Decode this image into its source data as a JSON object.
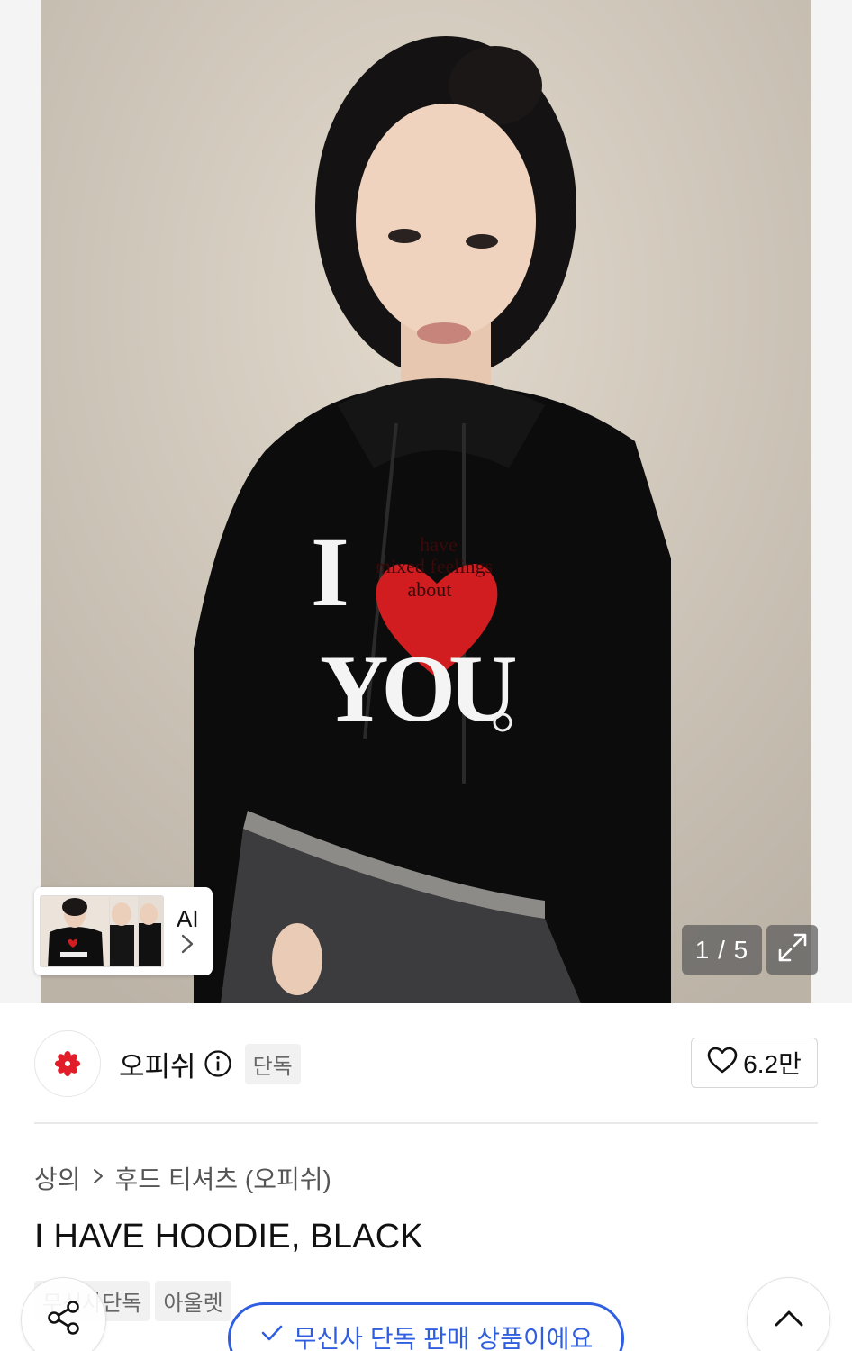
{
  "gallery": {
    "counter": "1 / 5",
    "ai_label": "AI",
    "photo_text": {
      "line1": "I",
      "heart_text": [
        "have",
        "mixed feelings",
        "about"
      ],
      "line2": "YOU"
    }
  },
  "brand": {
    "name": "오피쉬",
    "badge": "단독",
    "likes": "6.2만"
  },
  "breadcrumb": {
    "items": [
      "상의",
      "후드 티셔츠 (오피쉬)"
    ]
  },
  "product": {
    "title": "I HAVE HOODIE, BLACK",
    "tags": [
      "무신사단독",
      "아울렛"
    ]
  },
  "banner": {
    "label": "무신사 단독 판매 상품이에요"
  },
  "colors": {
    "accent": "#2f5ee0",
    "logo_red": "#e11d2a"
  }
}
